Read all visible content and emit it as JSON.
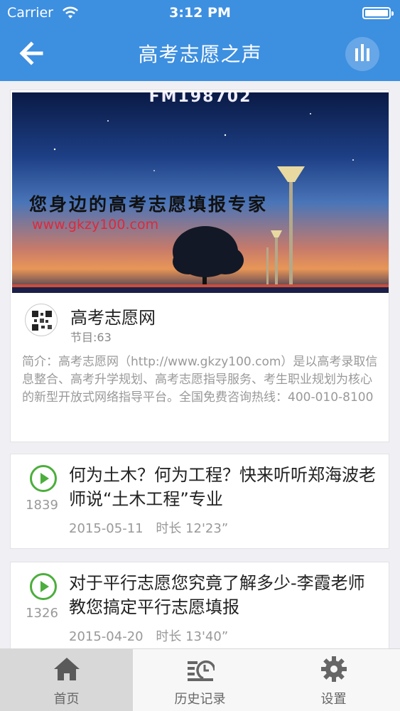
{
  "status_bar": {
    "carrier": "Carrier",
    "time": "3:12 PM"
  },
  "nav": {
    "title": "高考志愿之声",
    "back_icon": "back-arrow-icon",
    "action_icon": "equalizer-icon"
  },
  "program": {
    "banner": {
      "fm_text": "FM198702",
      "slogan": "您身边的高考志愿填报专家",
      "url": "www.gkzy100.com"
    },
    "name": "高考志愿网",
    "episode_count": "节目:63",
    "intro": "简介：高考志愿网（http://www.gkzy100.com）是以高考录取信息整合、高考升学规划、高考志愿指导服务、考生职业规划为核心的新型开放式网络指导平台。全国免费咨询热线：400-010-8100"
  },
  "episodes": [
    {
      "title": "何为土木？何为工程？快来听听郑海波老师说“土木工程”专业",
      "plays": "1839",
      "date": "2015-05-11",
      "duration": "时长 12'23”"
    },
    {
      "title": "对于平行志愿您究竟了解多少-李霞老师教您搞定平行志愿填报",
      "plays": "1326",
      "date": "2015-04-20",
      "duration": "时长 13'40”"
    }
  ],
  "tabbar": {
    "tabs": [
      {
        "label": "首页",
        "icon": "home-icon",
        "active": true
      },
      {
        "label": "历史记录",
        "icon": "history-icon",
        "active": false
      },
      {
        "label": "设置",
        "icon": "gear-icon",
        "active": false
      }
    ]
  },
  "colors": {
    "nav_blue": "#3d8fe0",
    "play_green": "#4cae3c",
    "tab_active_bg": "#d8d8d8"
  }
}
